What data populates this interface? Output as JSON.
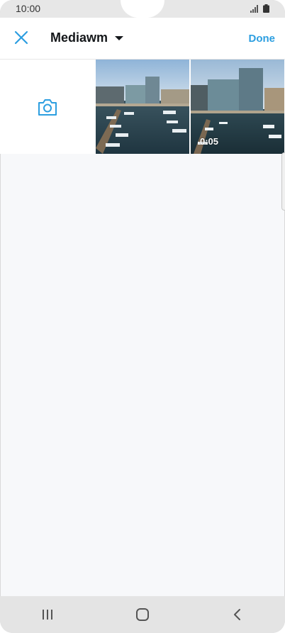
{
  "status_bar": {
    "time": "10:00"
  },
  "header": {
    "album_title": "Mediawm",
    "done_label": "Done",
    "accent_color": "#2c9ee0"
  },
  "grid": {
    "video_duration": "0:05"
  },
  "icons": {
    "close": "close-icon",
    "dropdown": "caret-down-icon",
    "camera": "camera-icon",
    "recent_apps": "recent-apps-icon",
    "home": "home-icon",
    "back": "back-icon"
  }
}
